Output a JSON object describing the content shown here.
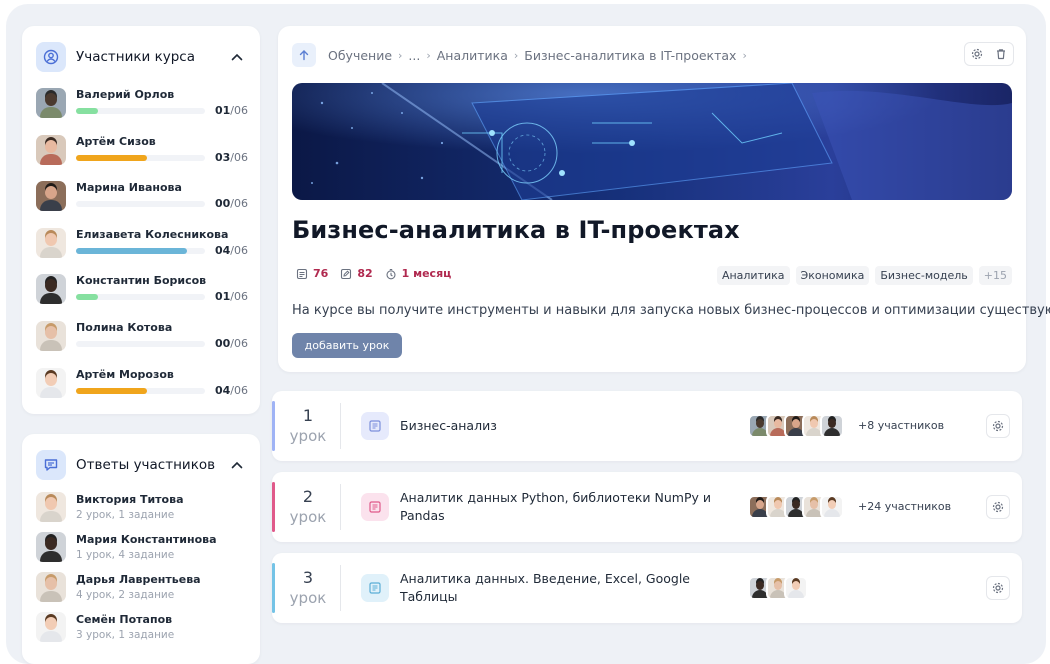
{
  "members_panel": {
    "title": "Участники курса",
    "members": [
      {
        "name": "Валерий Орлов",
        "done": "01",
        "total": "/06",
        "progress": 0.17,
        "color": "#86e0a0"
      },
      {
        "name": "Артём Сизов",
        "done": "03",
        "total": "/06",
        "progress": 0.55,
        "color": "#f0a51c"
      },
      {
        "name": "Марина Иванова",
        "done": "00",
        "total": "/06",
        "progress": 0,
        "color": "#f1f3f7"
      },
      {
        "name": "Елизавета Колесникова",
        "done": "04",
        "total": "/06",
        "progress": 0.86,
        "color": "#6bb5d8"
      },
      {
        "name": "Константин Борисов",
        "done": "01",
        "total": "/06",
        "progress": 0.17,
        "color": "#86e0a0"
      },
      {
        "name": "Полина Котова",
        "done": "00",
        "total": "/06",
        "progress": 0,
        "color": "#f1f3f7"
      },
      {
        "name": "Артём Морозов",
        "done": "04",
        "total": "/06",
        "progress": 0.55,
        "color": "#f0a51c"
      }
    ]
  },
  "answers_panel": {
    "title": "Ответы участников",
    "answers": [
      {
        "name": "Виктория Титова",
        "sub": "2 урок, 1 задание"
      },
      {
        "name": "Мария Константинова",
        "sub": "1 урок, 4 задание"
      },
      {
        "name": "Дарья Лаврентьева",
        "sub": "4 урок, 2 задание"
      },
      {
        "name": "Семён Потапов",
        "sub": "3 урок, 1 задание"
      }
    ]
  },
  "course": {
    "breadcrumbs": [
      "Обучение",
      "...",
      "Аналитика",
      "Бизнес-аналитика в IT-проектах"
    ],
    "title": "Бизнес-аналитика в IT-проектах",
    "stats": {
      "lessons": "76",
      "tasks": "82",
      "duration": "1 месяц"
    },
    "tags": [
      "Аналитика",
      "Экономика",
      "Бизнес-модель"
    ],
    "more_tags": "+15",
    "description": "На курсе вы получите инструменты и навыки для запуска новых бизнес-процессов и оптимизации существующих.",
    "add_button": "добавить урок"
  },
  "lesson_word": "урок",
  "lessons": [
    {
      "number": "1",
      "title": "Бизнес-анализ",
      "participants": "+8 участников",
      "accent": "#9fb3f5",
      "icon_bg": "#e6eafc",
      "icon_color": "#7c8fdc"
    },
    {
      "number": "2",
      "title": "Аналитик данных Python, библиотеки NumPy и Pandas",
      "participants": "+24 участников",
      "accent": "#e05a8a",
      "icon_bg": "#fbe2ed",
      "icon_color": "#e05a8a"
    },
    {
      "number": "3",
      "title": "Аналитика данных. Введение, Excel, Google Таблицы",
      "participants": "",
      "accent": "#74c3e6",
      "icon_bg": "#e0f1fa",
      "icon_color": "#5aaed6"
    }
  ],
  "colors": {
    "accent_red": "#b0294f",
    "button": "#6f84aa",
    "frame": "#eef1f6"
  }
}
